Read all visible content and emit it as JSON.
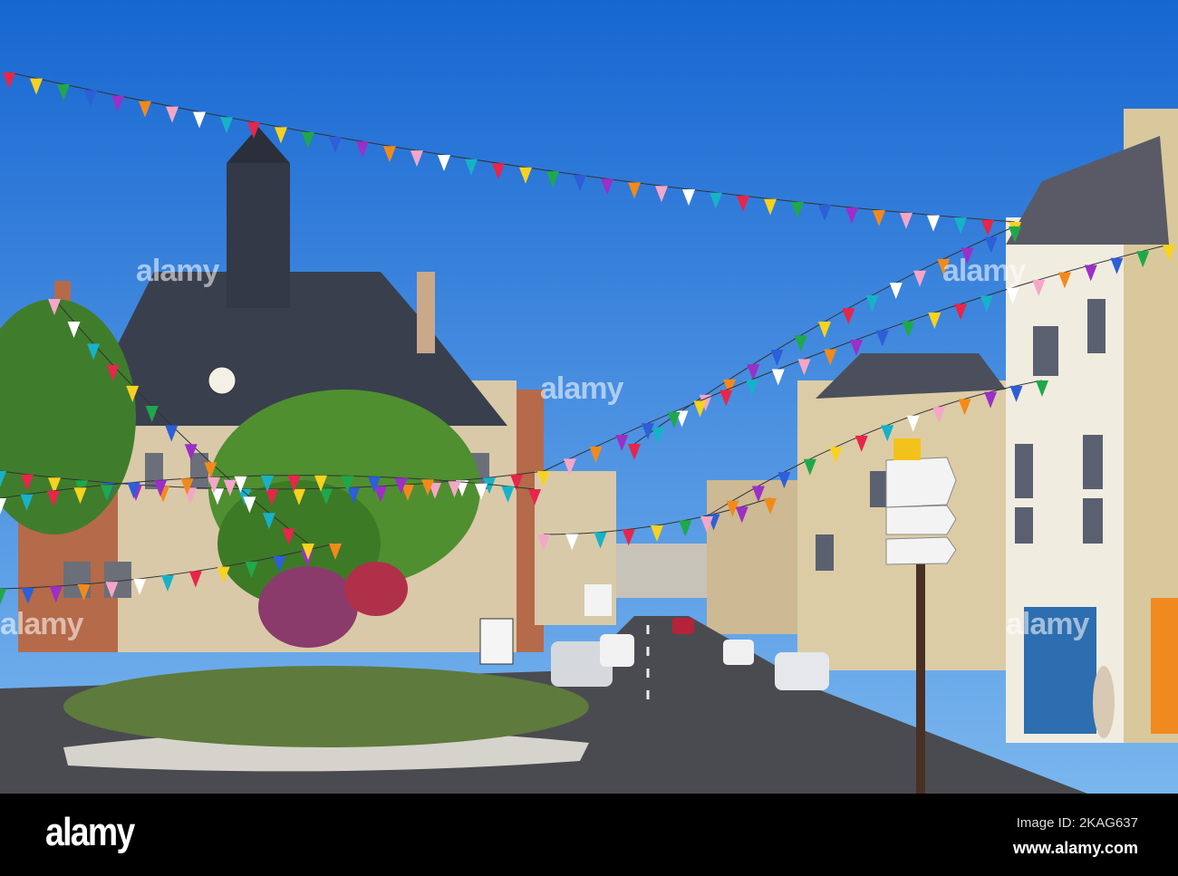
{
  "watermark": {
    "text": "alamy"
  },
  "footer": {
    "logo": "alamy",
    "image_id": "Image ID: 2KAG637",
    "url": "www.alamy.com"
  },
  "colors": {
    "sky_top": "#1a6fd6",
    "sky_bottom": "#6fb0ee",
    "bunting": [
      "#e8254a",
      "#f7d21e",
      "#1fa84a",
      "#2c5fd8",
      "#9b2fc7",
      "#f28a1a",
      "#f5a6c8",
      "#ffffff",
      "#16b2c9"
    ]
  }
}
